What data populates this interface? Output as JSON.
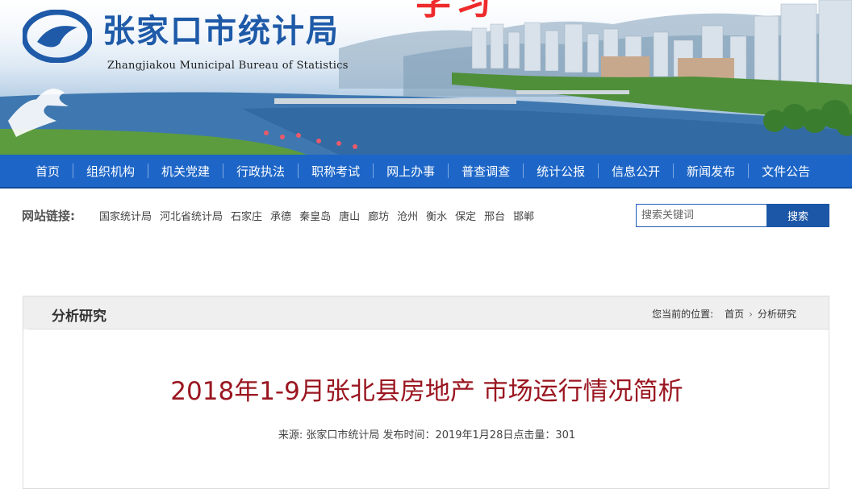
{
  "header": {
    "site_title": "张家口市统计局",
    "site_subtitle": "Zhangjiakou Municipal  Bureau of Statistics",
    "banner_word": "学习",
    "colors": {
      "title": "#1e5aa8",
      "nav_bg": "#1d66c8",
      "accent_red": "#9a1620"
    }
  },
  "nav": {
    "items": [
      {
        "label": "首页"
      },
      {
        "label": "组织机构"
      },
      {
        "label": "机关党建"
      },
      {
        "label": "行政执法"
      },
      {
        "label": "职称考试"
      },
      {
        "label": "网上办事"
      },
      {
        "label": "普查调查"
      },
      {
        "label": "统计公报"
      },
      {
        "label": "信息公开"
      },
      {
        "label": "新闻发布"
      },
      {
        "label": "文件公告"
      }
    ]
  },
  "links": {
    "label": "网站链接:",
    "items": [
      "国家统计局",
      "河北省统计局",
      "石家庄",
      "承德",
      "秦皇岛",
      "唐山",
      "廊坊",
      "沧州",
      "衡水",
      "保定",
      "邢台",
      "邯郸"
    ]
  },
  "search": {
    "placeholder": "搜索关键词",
    "button_label": "搜索"
  },
  "section": {
    "title": "分析研究",
    "breadcrumb_prefix": "您当前的位置:",
    "breadcrumb": [
      "首页",
      "分析研究"
    ]
  },
  "article": {
    "title": "2018年1-9月张北县房地产 市场运行情况简析",
    "meta": "来源:  张家口市统计局 发布时间：2019年1月28日点击量：301"
  }
}
